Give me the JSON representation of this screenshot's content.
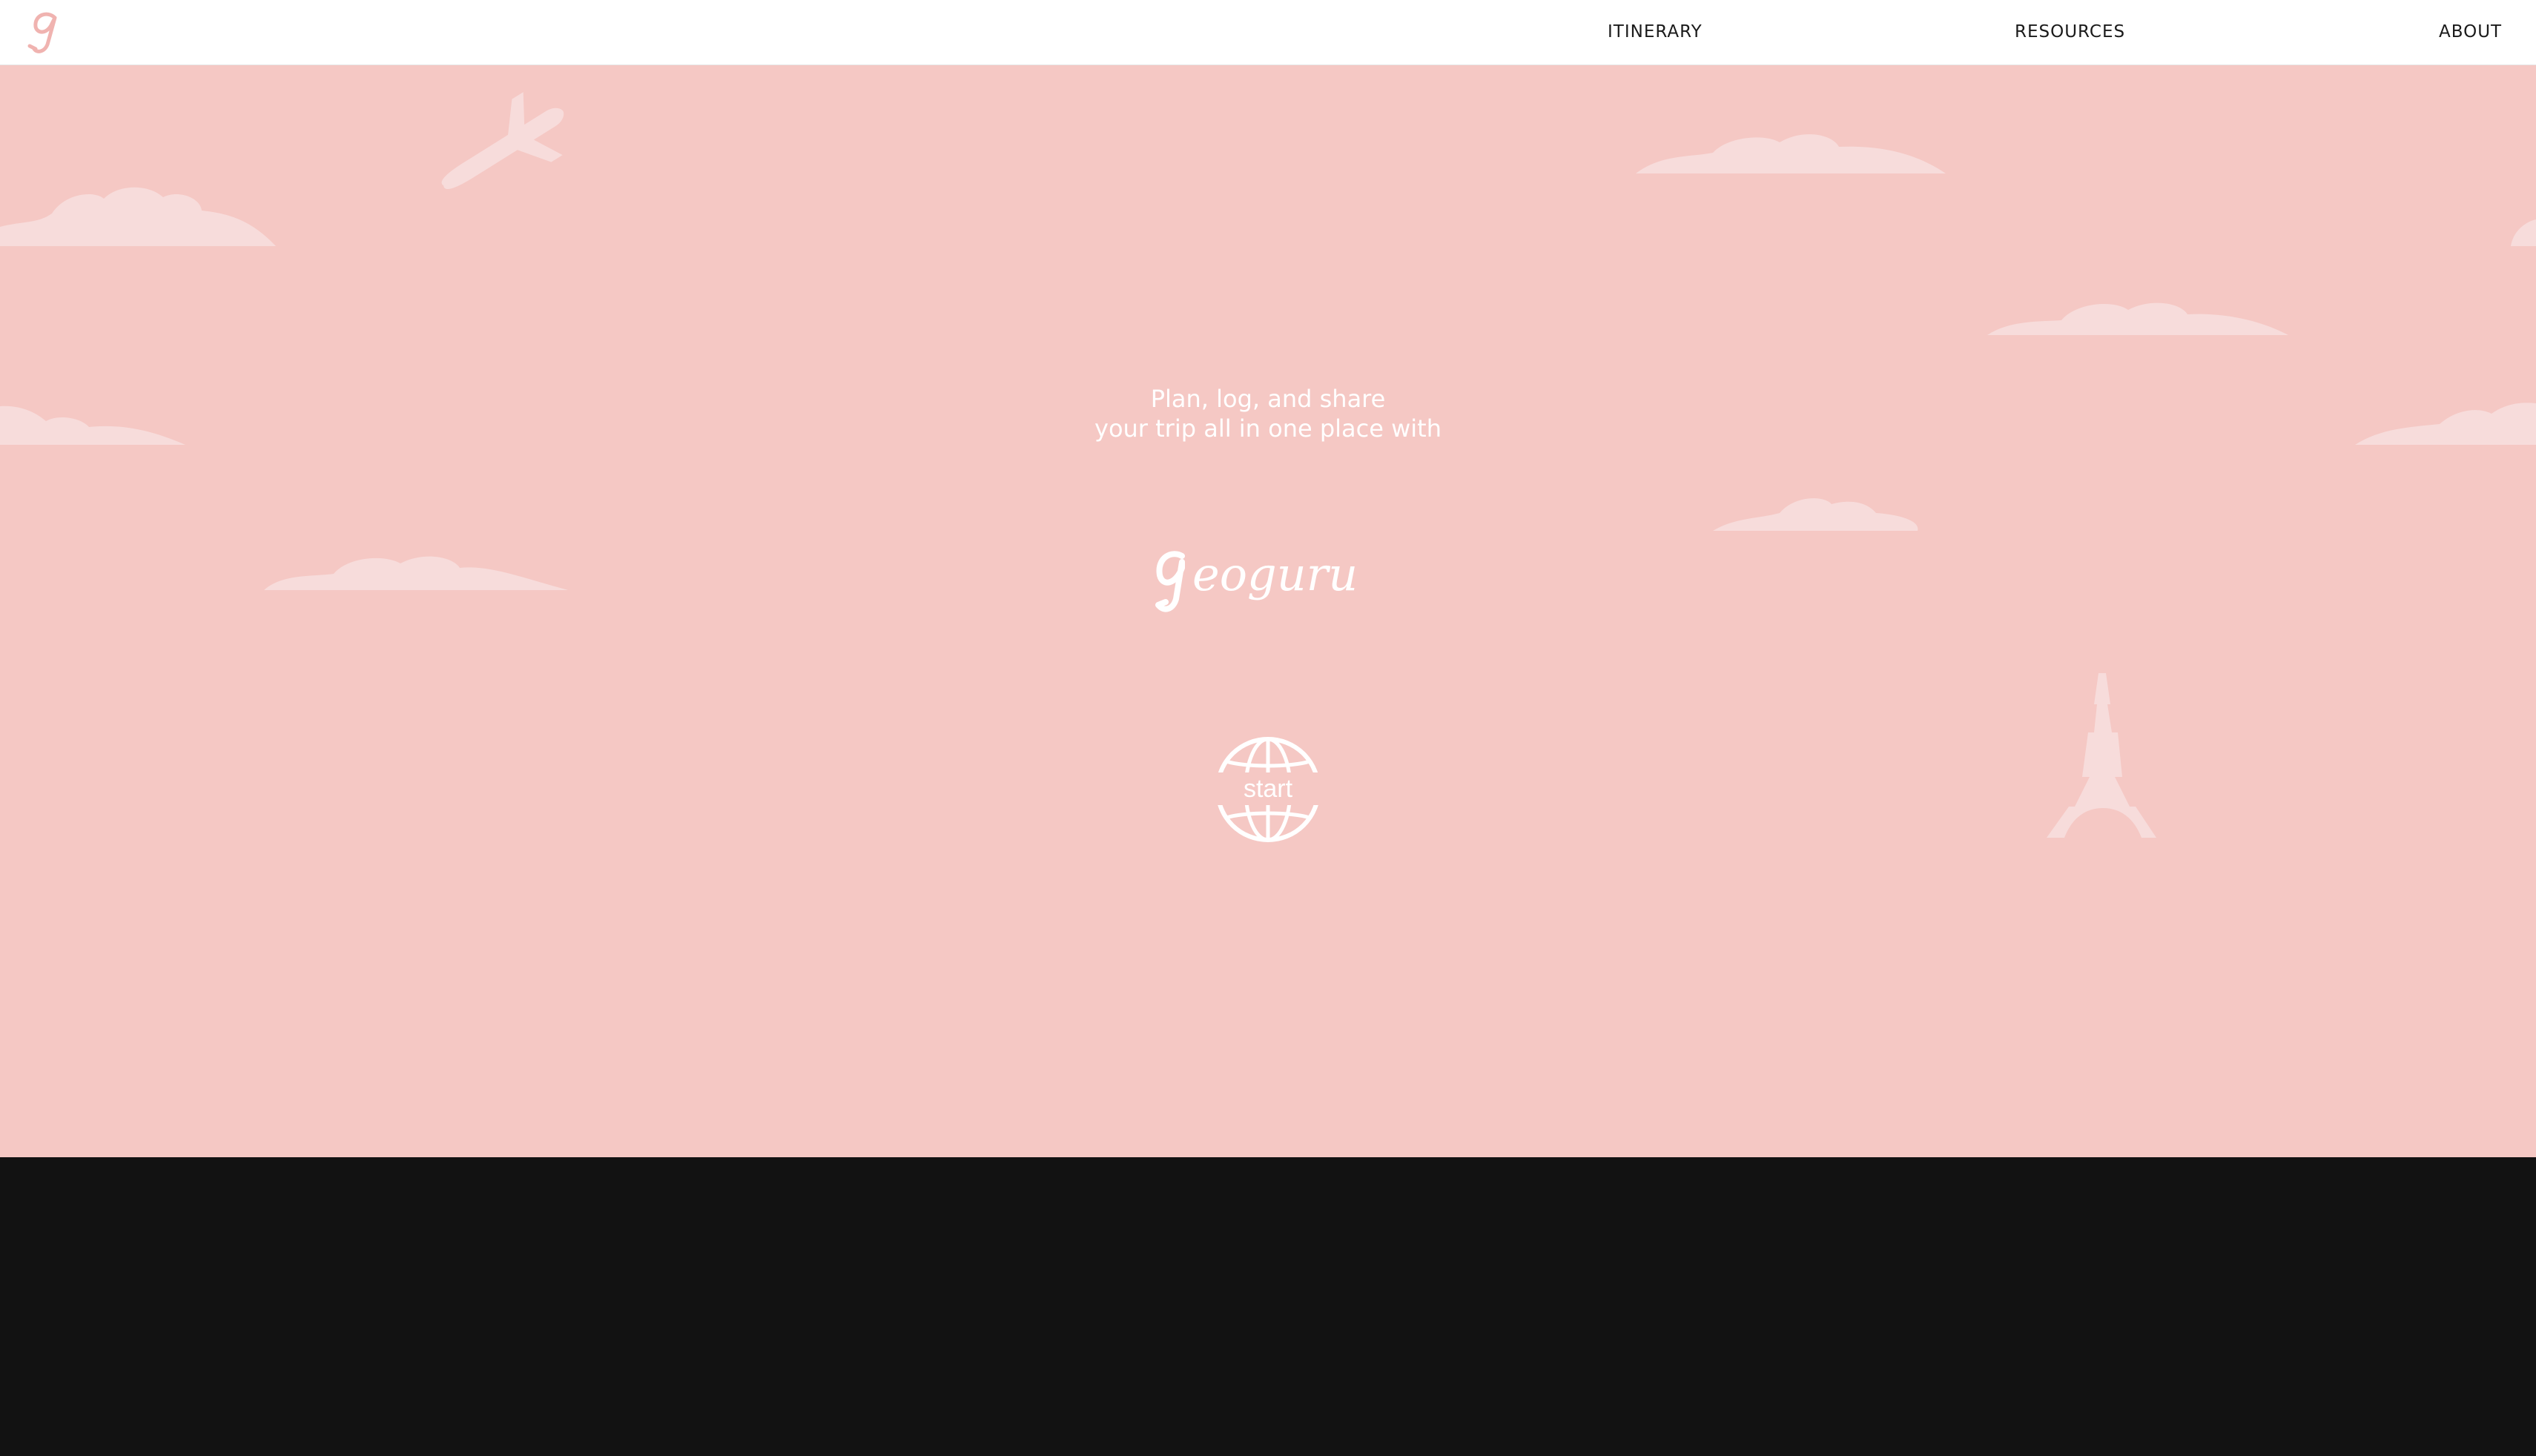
{
  "brand": {
    "logo_icon": "g-script-logo-icon",
    "wordmark": "Geoguru"
  },
  "nav": {
    "items": [
      {
        "label": "ITINERARY"
      },
      {
        "label": "RESOURCES"
      },
      {
        "label": "ABOUT"
      }
    ]
  },
  "hero": {
    "tagline_line1": "Plan, log, and share",
    "tagline_line2": "your trip all in one place with",
    "start_label": "start",
    "start_icon": "globe-icon",
    "decorations": [
      "cloud-icon",
      "airplane-icon",
      "eiffel-tower-icon"
    ]
  },
  "colors": {
    "hero_background": "#f5c8c4",
    "decoration": "#f7dcdb",
    "footer_background": "#121212",
    "nav_background": "#ffffff",
    "text_light": "#ffffff",
    "logo_pink": "#f0b3b0"
  }
}
